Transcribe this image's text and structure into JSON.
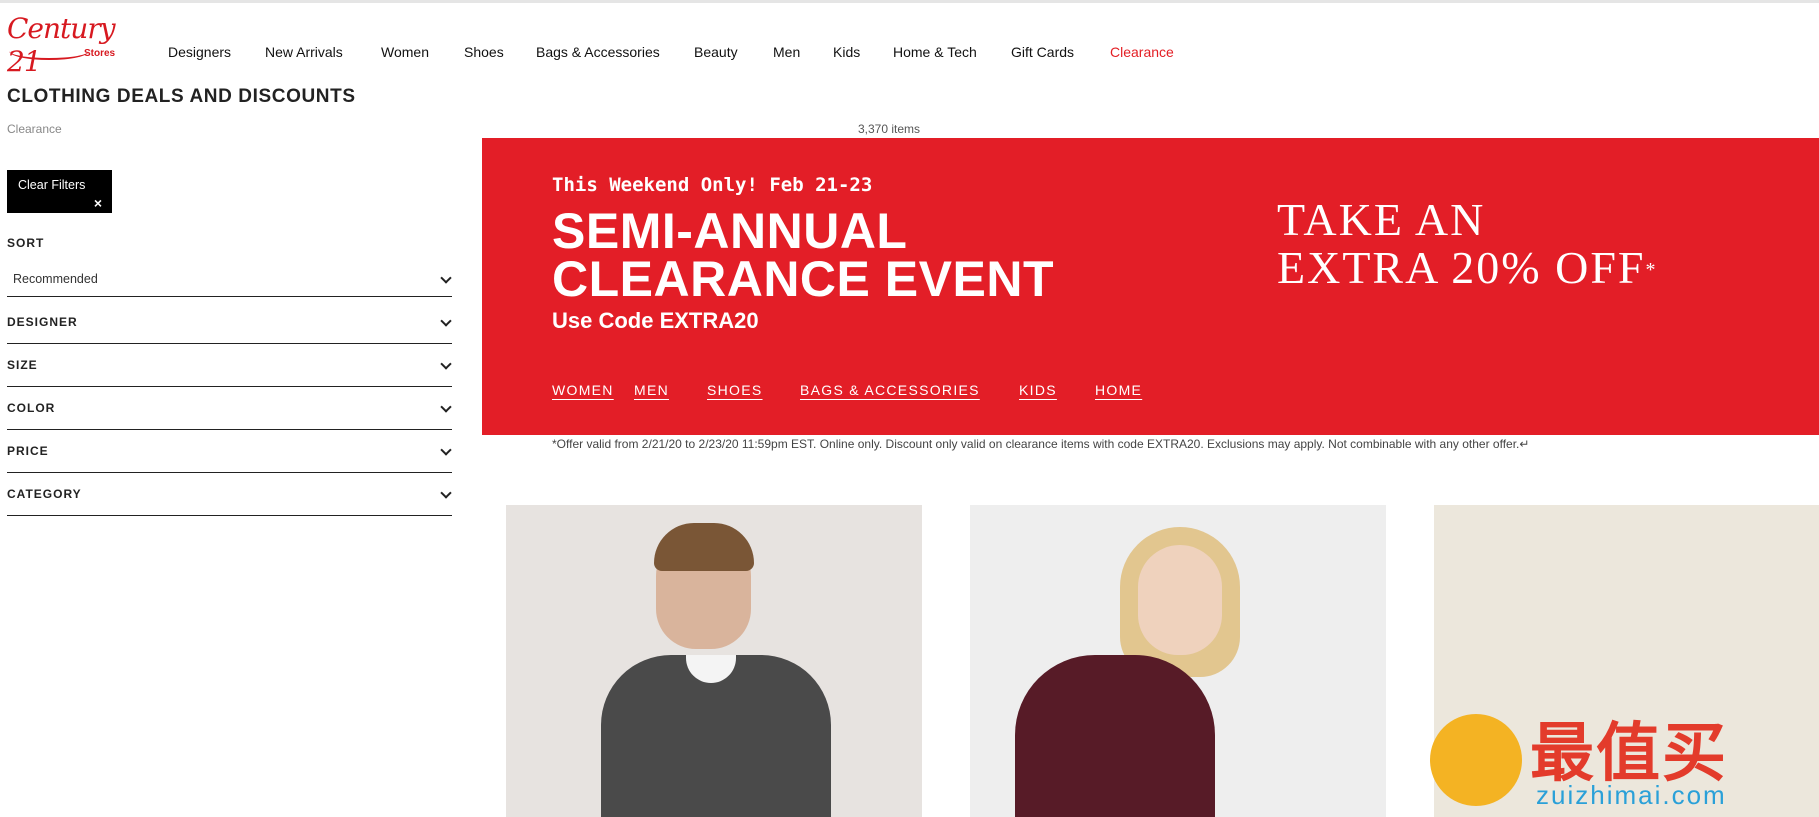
{
  "header": {
    "logo_text": "Century 21",
    "logo_sub": "Stores",
    "nav": [
      "Designers",
      "New Arrivals",
      "Women",
      "Shoes",
      "Bags & Accessories",
      "Beauty",
      "Men",
      "Kids",
      "Home & Tech",
      "Gift Cards",
      "Clearance"
    ]
  },
  "page": {
    "title": "CLOTHING DEALS AND DISCOUNTS",
    "breadcrumb": "Clearance",
    "item_count": "3,370 items"
  },
  "sidebar": {
    "clear_filters": "Clear Filters",
    "clear_x": "×",
    "sort_label": "SORT",
    "sort_value": "Recommended",
    "facets": [
      "DESIGNER",
      "SIZE",
      "COLOR",
      "PRICE",
      "CATEGORY"
    ]
  },
  "banner": {
    "weekend": "This Weekend Only! Feb 21-23",
    "title_line1": "SEMI-ANNUAL",
    "title_line2": "CLEARANCE EVENT",
    "code": "Use Code EXTRA20",
    "offer_line1": "TAKE AN",
    "offer_line2": "EXTRA 20% OFF",
    "offer_mark": "*",
    "links": [
      "WOMEN",
      "MEN",
      "SHOES",
      "BAGS & ACCESSORIES",
      "KIDS",
      "HOME"
    ],
    "color": "#e31e27"
  },
  "disclaimer": "*Offer valid from 2/21/20 to 2/23/20 11:59pm EST. Online only. Discount only valid on clearance items with code EXTRA20. Exclusions may apply. Not combinable with any other offer.↵",
  "watermark": {
    "text": "最值买",
    "url": "zuizhimai.com"
  }
}
